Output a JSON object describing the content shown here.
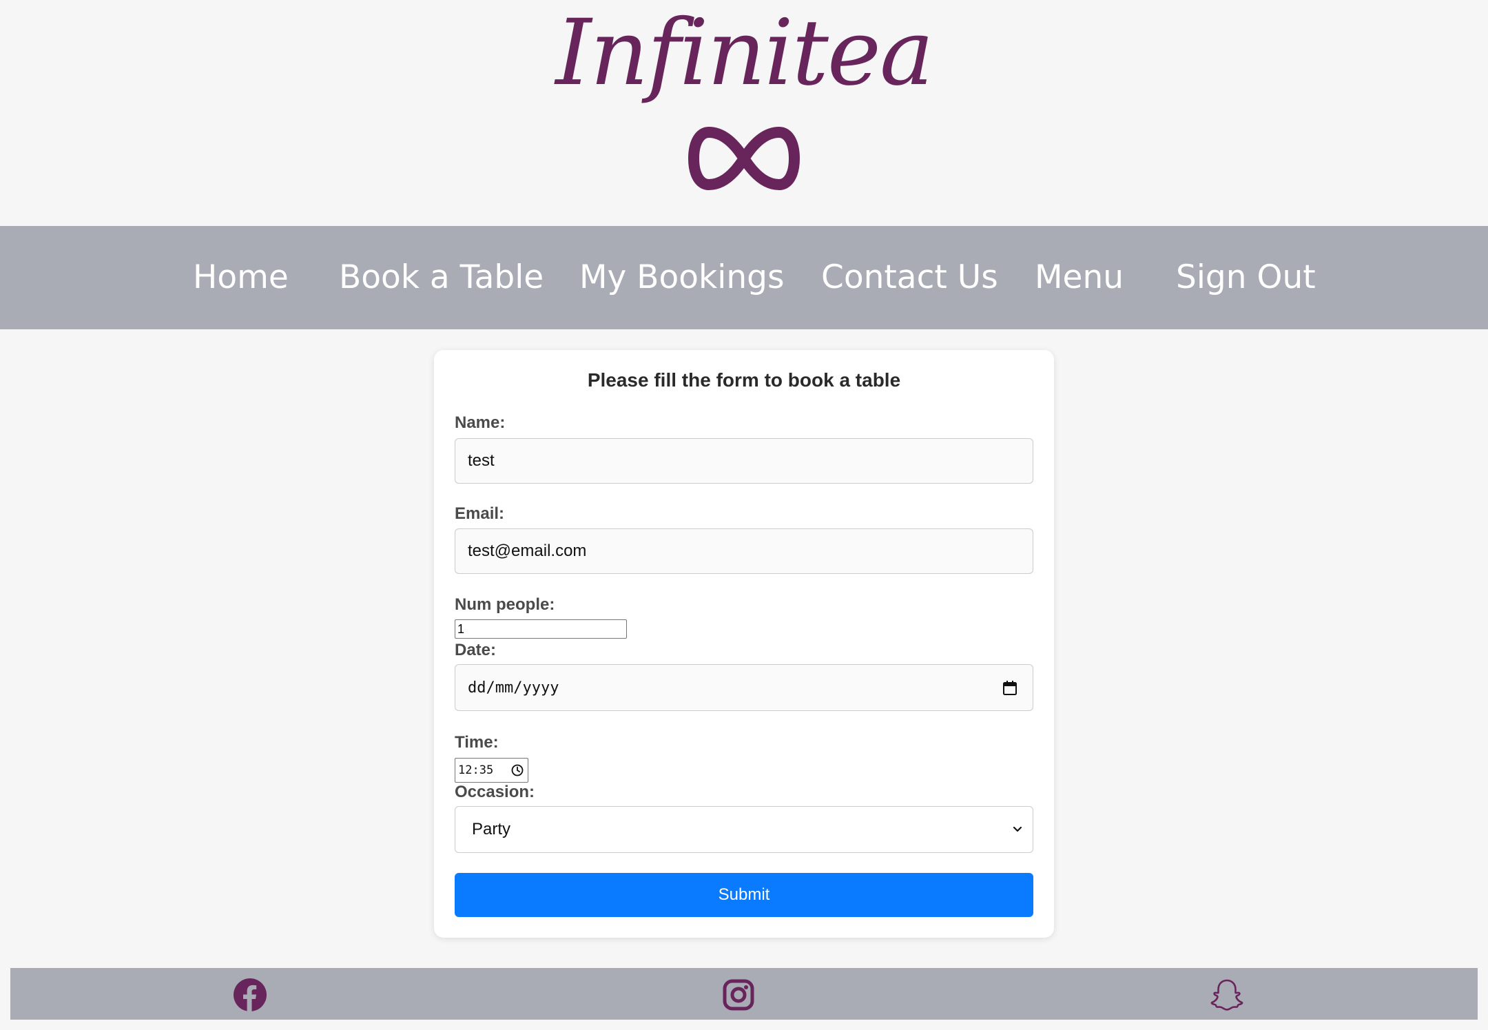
{
  "brand": {
    "name": "Infinitea",
    "logo_icon": "infinity-icon",
    "color": "#68255c"
  },
  "nav": {
    "items": [
      {
        "label": "Home"
      },
      {
        "label": "Book a Table"
      },
      {
        "label": "My Bookings"
      },
      {
        "label": "Contact Us"
      },
      {
        "label": "Menu"
      },
      {
        "label": "Sign Out"
      }
    ],
    "background": "#a9abb5"
  },
  "form": {
    "title": "Please fill the form to book a table",
    "name_label": "Name:",
    "name_value": "test",
    "email_label": "Email:",
    "email_value": "test@email.com",
    "num_people_label": "Num people:",
    "num_people_value": "1",
    "date_label": "Date:",
    "date_placeholder": "dd/mm/yyyy",
    "date_icon": "calendar-icon",
    "time_label": "Time:",
    "time_value": "12:35",
    "time_icon": "clock-icon",
    "occasion_label": "Occasion:",
    "occasion_value": "Party",
    "submit_label": "Submit",
    "submit_color": "#0a7bff"
  },
  "footer": {
    "icons": [
      "facebook-icon",
      "instagram-icon",
      "snapchat-icon"
    ]
  }
}
